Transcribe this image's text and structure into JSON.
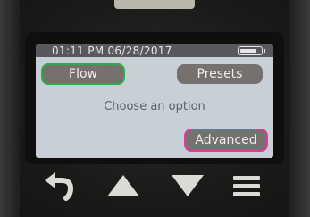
{
  "status_bar": {
    "datetime": "01:11 PM 06/28/2017",
    "battery_level_percent": 100
  },
  "screen": {
    "buttons": {
      "flow": "Flow",
      "presets": "Presets",
      "advanced": "Advanced"
    },
    "prompt": "Choose an option",
    "highlight_colors": {
      "flow": "#2faa4a",
      "advanced": "#e5399b"
    }
  },
  "hardware_buttons": {
    "icons": [
      "back-arrow-icon",
      "up-triangle-icon",
      "down-triangle-icon",
      "menu-icon"
    ]
  }
}
